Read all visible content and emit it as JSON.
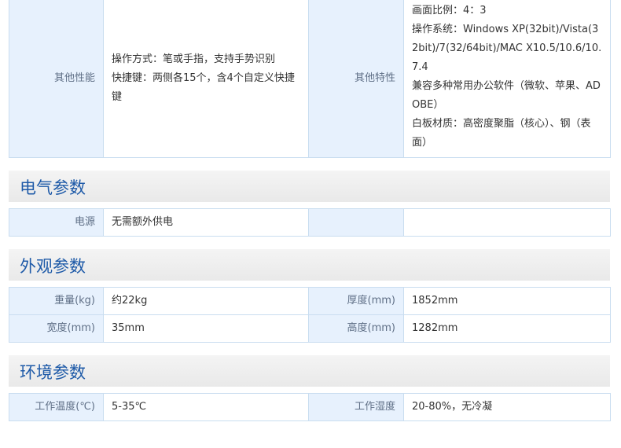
{
  "block1": {
    "left_key": "其他性能",
    "left_lines": [
      "操作方式：笔或手指，支持手势识别",
      "快捷键：两侧各15个，含4个自定义快捷键"
    ],
    "right_key": "其他特性",
    "right_lines": [
      "画面比例：4：3",
      "操作系统：Windows XP(32bit)/Vista(32bit)/7(32/64bit)/MAC X10.5/10.6/10.7.4",
      "兼容多种常用办公软件（微软、苹果、ADOBE）",
      "白板材质：高密度聚脂（核心）、钢（表面）"
    ]
  },
  "electric": {
    "title": "电气参数",
    "row1": {
      "k1": "电源",
      "v1": "无需额外供电",
      "k2": "",
      "v2": ""
    }
  },
  "appearance": {
    "title": "外观参数",
    "row1": {
      "k1": "重量(kg)",
      "v1": "约22kg",
      "k2": "厚度(mm)",
      "v2": "1852mm"
    },
    "row2": {
      "k1": "宽度(mm)",
      "v1": "35mm",
      "k2": "高度(mm)",
      "v2": "1282mm"
    }
  },
  "environment": {
    "title": "环境参数",
    "row1": {
      "k1": "工作温度(℃)",
      "v1": "5-35℃",
      "k2": "工作湿度",
      "v2": "20-80%，无冷凝"
    }
  },
  "colors": {
    "section_title": "#1e5aa8",
    "key_bg": "#e7f1fd",
    "border": "#c9ddf0",
    "section_bg": "#ececec"
  }
}
